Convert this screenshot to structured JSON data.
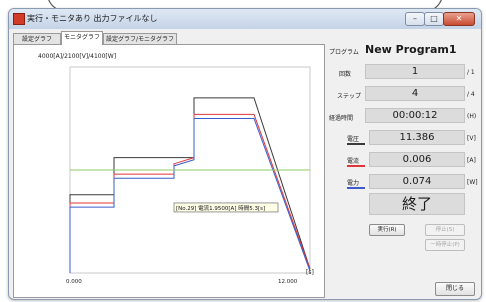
{
  "window": {
    "title": "実行・モニタあり 出力ファイルなし",
    "minimize_glyph": "–",
    "maximize_glyph": "□",
    "close_glyph": "✕"
  },
  "tabs": [
    {
      "label": "設定グラフ"
    },
    {
      "label": "モニタグラフ"
    },
    {
      "label": "設定グラフ/モニタグラフ"
    }
  ],
  "graph": {
    "y_label": "4000[A]/2100[V]/4100[W]",
    "x_unit": "[s]",
    "x_min_label": "0.000",
    "x_max_label": "12.000",
    "tooltip": "[No.29] 電流1.9500[A] 時間5.3[s]"
  },
  "chart_data": {
    "type": "line",
    "x_unit": "s",
    "xlim": [
      0,
      12
    ],
    "x_tick_labels": [
      "0.000",
      "12.000"
    ],
    "ylabel": "4000[A]/2100[V]/4100[W]",
    "series": [
      {
        "color": "#3a3a3a",
        "x": [
          0,
          0,
          2.2,
          2.2,
          5.2,
          5.2,
          6.2,
          6.2,
          9.2,
          12
        ],
        "y": [
          0,
          0.38,
          0.38,
          0.56,
          0.56,
          0.56,
          0.56,
          0.85,
          0.85,
          0.02
        ]
      },
      {
        "color": "#e0363a",
        "x": [
          0,
          0,
          2.2,
          2.2,
          5.2,
          5.2,
          6.2,
          6.2,
          9.2,
          12
        ],
        "y": [
          0,
          0.34,
          0.34,
          0.48,
          0.48,
          0.53,
          0.56,
          0.77,
          0.77,
          0.02
        ]
      },
      {
        "color": "#3a5bc9",
        "x": [
          0,
          0,
          2.2,
          2.2,
          5.2,
          5.2,
          6.2,
          6.2,
          9.2,
          12
        ],
        "y": [
          0,
          0.32,
          0.32,
          0.46,
          0.46,
          0.52,
          0.55,
          0.75,
          0.75,
          0.01
        ]
      },
      {
        "color": "#8fcb63",
        "x": [
          0,
          12
        ],
        "y": [
          0.5,
          0.5
        ]
      }
    ]
  },
  "program": {
    "label": "プログラム",
    "value": "New Program1"
  },
  "cycle": {
    "label": "回数",
    "value": "1",
    "unit": "/ 1"
  },
  "step": {
    "label": "ステップ",
    "value": "4",
    "unit": "/ 4"
  },
  "elapsed": {
    "label": "経過時間",
    "value": "00:00:12",
    "unit": "(H)"
  },
  "voltage": {
    "label": "電圧",
    "value": "11.386",
    "unit": "[V]",
    "color": "#3a3a3a"
  },
  "current": {
    "label": "電流",
    "value": "0.006",
    "unit": "[A]",
    "color": "#e0363a"
  },
  "power": {
    "label": "電力",
    "value": "0.074",
    "unit": "[W]",
    "color": "#3a5bc9"
  },
  "status": {
    "value": "終了"
  },
  "buttons": {
    "run": "実行(R)",
    "stop": "停止(S)",
    "pause": "一時停止(P)",
    "close": "閉じる"
  }
}
